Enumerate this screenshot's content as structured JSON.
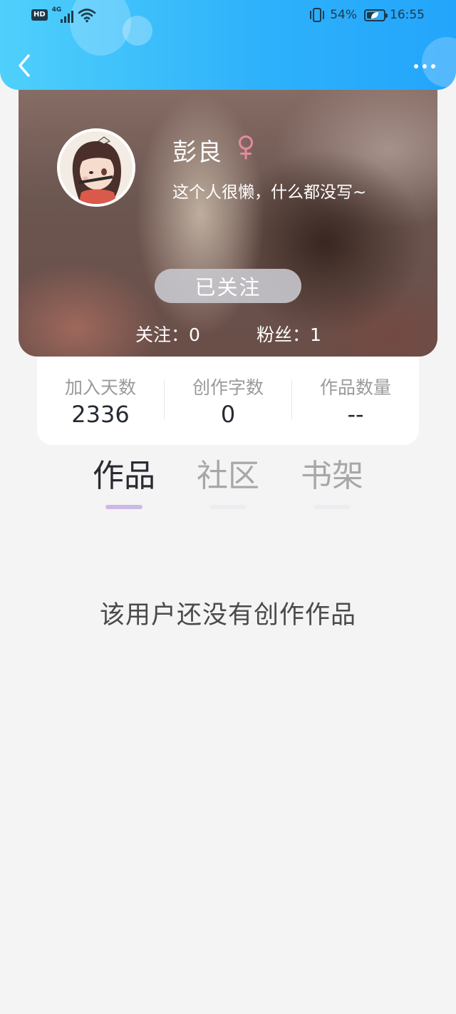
{
  "status_bar": {
    "network_badge": "HD",
    "network_type": "4G",
    "battery_percent": "54%",
    "battery_level": 0.54,
    "time": "16:55"
  },
  "header": {
    "back_icon": "chevron-left-icon",
    "more_icon": "more-horizontal-icon"
  },
  "profile": {
    "name": "彭良",
    "gender_symbol": "♀",
    "gender_color": "#e58a9e",
    "bio": "这个人很懒，什么都没写~",
    "follow_button": "已关注",
    "following_text": "关注：0",
    "fans_text": "粉丝：1"
  },
  "stats": [
    {
      "label": "加入天数",
      "value": "2336"
    },
    {
      "label": "创作字数",
      "value": "0"
    },
    {
      "label": "作品数量",
      "value": "--"
    }
  ],
  "tabs": [
    {
      "label": "作品",
      "active": true
    },
    {
      "label": "社区",
      "active": false
    },
    {
      "label": "书架",
      "active": false
    }
  ],
  "empty_state": "该用户还没有创作作品",
  "colors": {
    "header_start": "#4fd0fb",
    "header_end": "#23a5fb",
    "tab_indicator_active": "#cdb9e6"
  }
}
